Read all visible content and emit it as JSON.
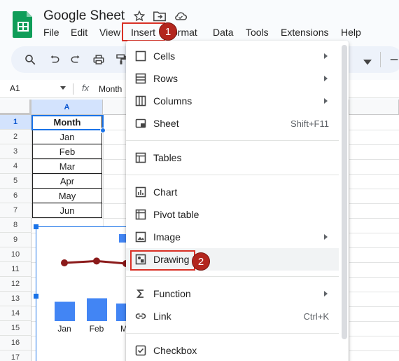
{
  "app": {
    "title": "Google Sheet",
    "brand_color": "#0f9d58"
  },
  "menubar": {
    "items": [
      "File",
      "Edit",
      "View",
      "Insert",
      "Format",
      "Data",
      "Tools",
      "Extensions",
      "Help"
    ],
    "visible_labels": {
      "file": "File",
      "edit": "Edit",
      "view": "View",
      "insert": "Insert",
      "format": "ormat",
      "data": "Data",
      "tools": "Tools",
      "extensions": "Extensions",
      "help": "Help"
    }
  },
  "badges": {
    "step1": "1",
    "step2": "2",
    "color": "#b3261e"
  },
  "formula_bar": {
    "cell_ref": "A1",
    "fx": "fx",
    "value": "Month"
  },
  "sheet": {
    "column_headers": [
      "A"
    ],
    "row_numbers": [
      "1",
      "2",
      "3",
      "4",
      "5",
      "6",
      "7",
      "8",
      "9",
      "10",
      "11",
      "12",
      "13",
      "14",
      "15",
      "16",
      "17"
    ],
    "cells": {
      "header": "Month",
      "values": [
        "Jan",
        "Feb",
        "Mar",
        "Apr",
        "May",
        "Jun"
      ]
    },
    "selected_cell": "A1"
  },
  "chart_data": {
    "type": "bar",
    "categories": [
      "Jan",
      "Feb",
      "Mar"
    ],
    "visible_labels": [
      "Jan",
      "Feb",
      "M"
    ],
    "series": [
      {
        "type": "bar",
        "values": [
          0.55,
          0.65,
          0.5
        ],
        "color": "#4285f4"
      },
      {
        "type": "line",
        "values": [
          0.55,
          0.58,
          0.5
        ],
        "color": "#8b1a1a"
      }
    ],
    "title": "",
    "xlabel": "",
    "ylabel": ""
  },
  "insert_menu": {
    "items": [
      {
        "label": "Cells",
        "icon": "cells-icon",
        "submenu": true
      },
      {
        "label": "Rows",
        "icon": "rows-icon",
        "submenu": true
      },
      {
        "label": "Columns",
        "icon": "columns-icon",
        "submenu": true
      },
      {
        "label": "Sheet",
        "icon": "sheet-icon",
        "shortcut": "Shift+F11"
      },
      {
        "label": "Tables",
        "icon": "table-icon"
      },
      {
        "label": "Chart",
        "icon": "chart-icon"
      },
      {
        "label": "Pivot table",
        "icon": "pivot-table-icon"
      },
      {
        "label": "Image",
        "icon": "image-icon",
        "submenu": true
      },
      {
        "label": "Drawing",
        "icon": "drawing-icon"
      },
      {
        "label": "Function",
        "icon": "sigma-icon",
        "submenu": true
      },
      {
        "label": "Link",
        "icon": "link-icon",
        "shortcut": "Ctrl+K"
      },
      {
        "label": "Checkbox",
        "icon": "checkbox-icon"
      }
    ]
  }
}
